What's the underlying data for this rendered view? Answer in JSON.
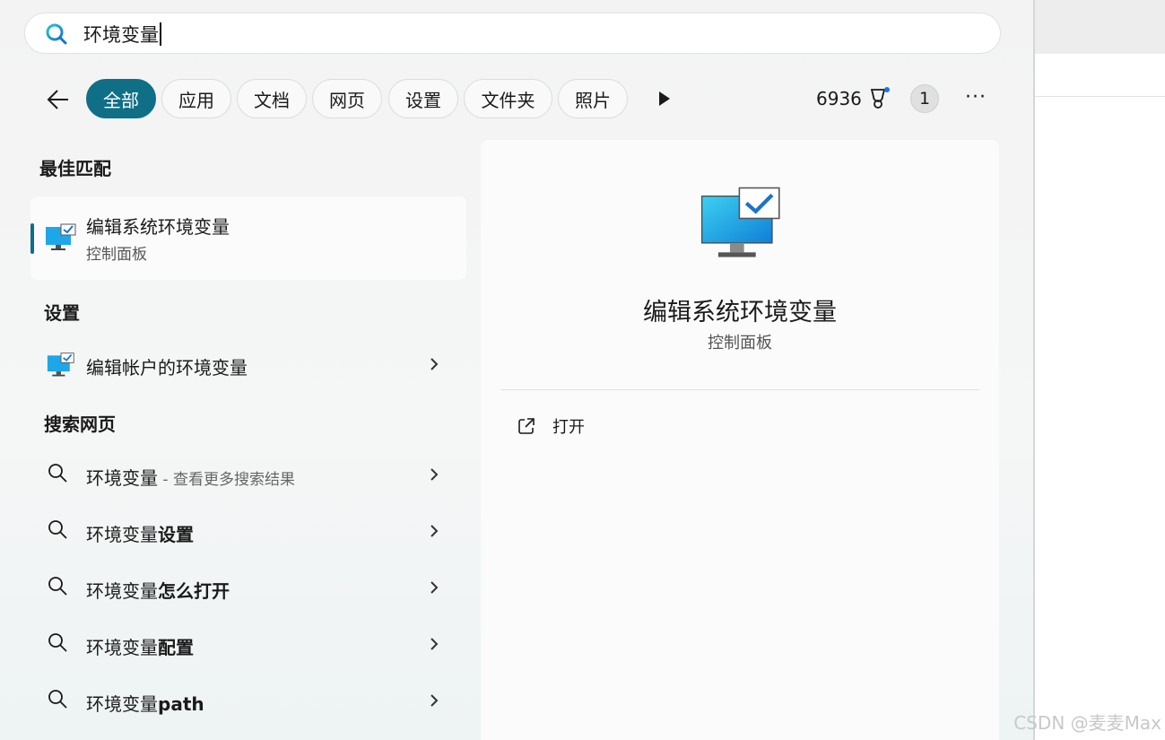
{
  "search": {
    "query": "环境变量"
  },
  "toolbar": {
    "filters": [
      {
        "label": "全部",
        "active": true
      },
      {
        "label": "应用"
      },
      {
        "label": "文档"
      },
      {
        "label": "网页"
      },
      {
        "label": "设置"
      },
      {
        "label": "文件夹"
      },
      {
        "label": "照片"
      }
    ],
    "points": "6936",
    "badge": "1"
  },
  "results": {
    "best_match_heading": "最佳匹配",
    "best_match": {
      "title": "编辑系统环境变量",
      "subtitle": "控制面板"
    },
    "settings_heading": "设置",
    "settings_item": "编辑帐户的环境变量",
    "web_heading": "搜索网页",
    "web_items": [
      {
        "prefix": "环境变量",
        "suffix": " - 查看更多搜索结果"
      },
      {
        "prefix": "环境变量",
        "bold": "设置"
      },
      {
        "prefix": "环境变量",
        "bold": "怎么打开"
      },
      {
        "prefix": "环境变量",
        "bold": "配置"
      },
      {
        "prefix": "环境变量",
        "bold": "path"
      }
    ]
  },
  "detail": {
    "title": "编辑系统环境变量",
    "subtitle": "控制面板",
    "action_label": "打开"
  },
  "watermark": "CSDN @麦麦Max",
  "colors": {
    "accent": "#0e6f86"
  }
}
